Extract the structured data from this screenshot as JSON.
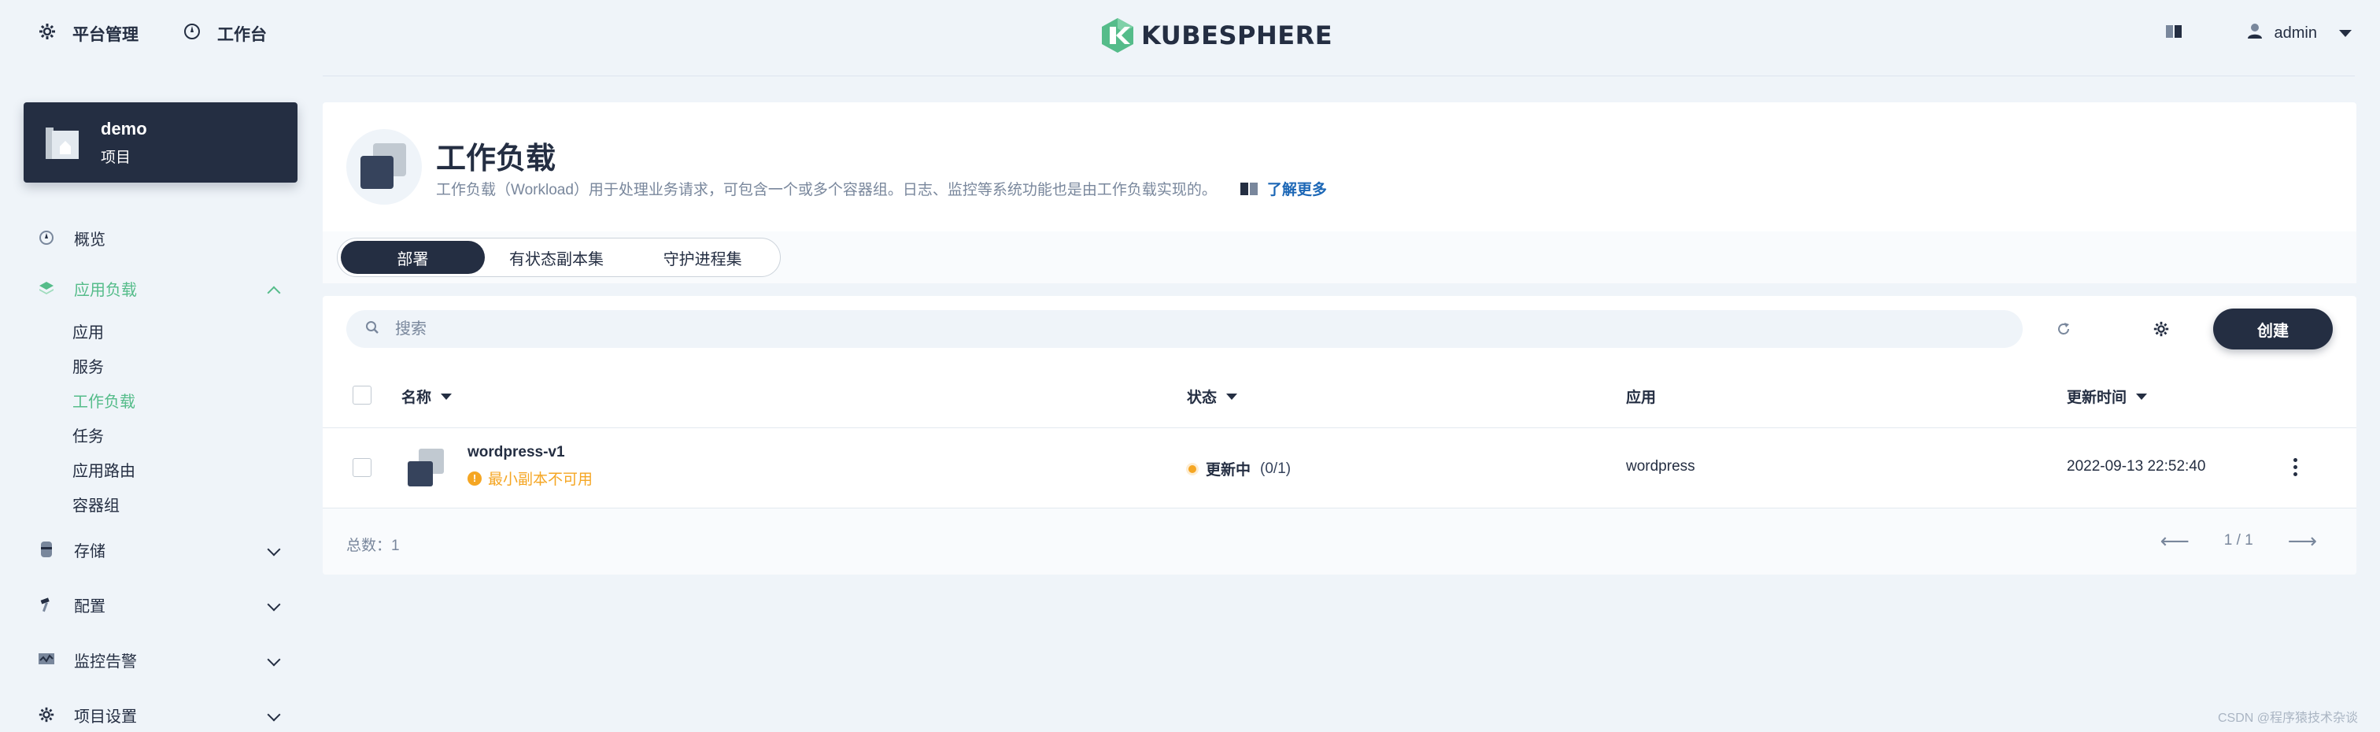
{
  "topbar": {
    "platform_label": "平台管理",
    "workbench_label": "工作台",
    "logo_text": "KUBESPHERE",
    "user_name": "admin"
  },
  "project": {
    "name": "demo",
    "type": "项目"
  },
  "nav": {
    "overview": "概览",
    "app_workloads": "应用负载",
    "sub_items": [
      "应用",
      "服务",
      "工作负载",
      "任务",
      "应用路由",
      "容器组"
    ],
    "storage": "存储",
    "config": "配置",
    "monitoring": "监控告警",
    "settings": "项目设置"
  },
  "banner": {
    "title": "工作负载",
    "description": "工作负载（Workload）用于处理业务请求，可包含一个或多个容器组。日志、监控等系统功能也是由工作负载实现的。",
    "learn_more": "了解更多"
  },
  "tabs": [
    "部署",
    "有状态副本集",
    "守护进程集"
  ],
  "toolbar": {
    "search_placeholder": "搜索",
    "create_label": "创建"
  },
  "table": {
    "headers": {
      "name": "名称",
      "status": "状态",
      "app": "应用",
      "updated": "更新时间"
    },
    "rows": [
      {
        "name": "wordpress-v1",
        "warning": "最小副本不可用",
        "status": "更新中",
        "replicas": "(0/1)",
        "app": "wordpress",
        "updated": "2022-09-13 22:52:40"
      }
    ]
  },
  "footer": {
    "total": "总数：1",
    "page": "1 / 1"
  },
  "watermark": "CSDN @程序猿技术杂谈",
  "colors": {
    "accent_green": "#55bc8a",
    "dark": "#242e42",
    "warning": "#f5a623",
    "background": "#eff4f9"
  }
}
